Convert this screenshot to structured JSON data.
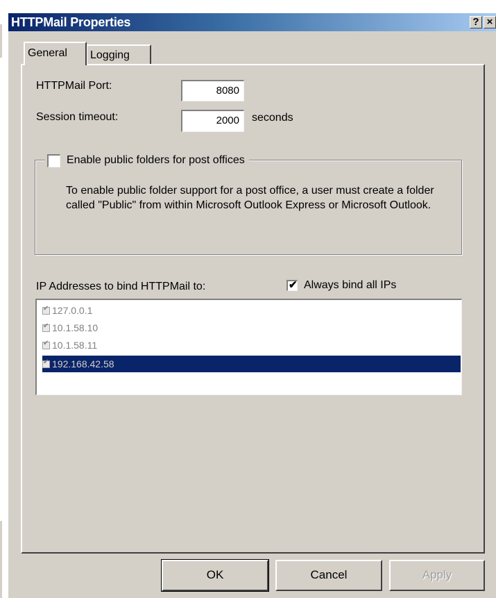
{
  "window": {
    "title": "HTTPMail Properties",
    "help_glyph": "?",
    "close_glyph": "×"
  },
  "tabs": [
    {
      "label": "General",
      "active": true
    },
    {
      "label": "Logging",
      "active": false
    }
  ],
  "general": {
    "port_label": "HTTPMail Port:",
    "port_value": "8080",
    "timeout_label": "Session timeout:",
    "timeout_value": "2000",
    "timeout_unit": "seconds"
  },
  "public_folders": {
    "checkbox_label": "Enable public folders for post offices",
    "checked": false,
    "description": "To enable public folder support for a post office, a user must create a folder called \"Public\" from within Microsoft Outlook Express or Microsoft Outlook."
  },
  "ip_binding": {
    "label": "IP Addresses to bind HTTPMail to:",
    "always_bind_label": "Always bind all IPs",
    "always_bind_checked": true,
    "addresses": [
      {
        "ip": "127.0.0.1",
        "checked": true,
        "selected": false
      },
      {
        "ip": "10.1.58.10",
        "checked": true,
        "selected": false
      },
      {
        "ip": "10.1.58.11",
        "checked": true,
        "selected": false
      },
      {
        "ip": "192.168.42.58",
        "checked": true,
        "selected": true
      }
    ]
  },
  "buttons": {
    "ok": "OK",
    "cancel": "Cancel",
    "apply": "Apply"
  },
  "colors": {
    "dialog_face": "#d4d0c8",
    "title_start": "#0a246a",
    "selection": "#0a246a"
  }
}
